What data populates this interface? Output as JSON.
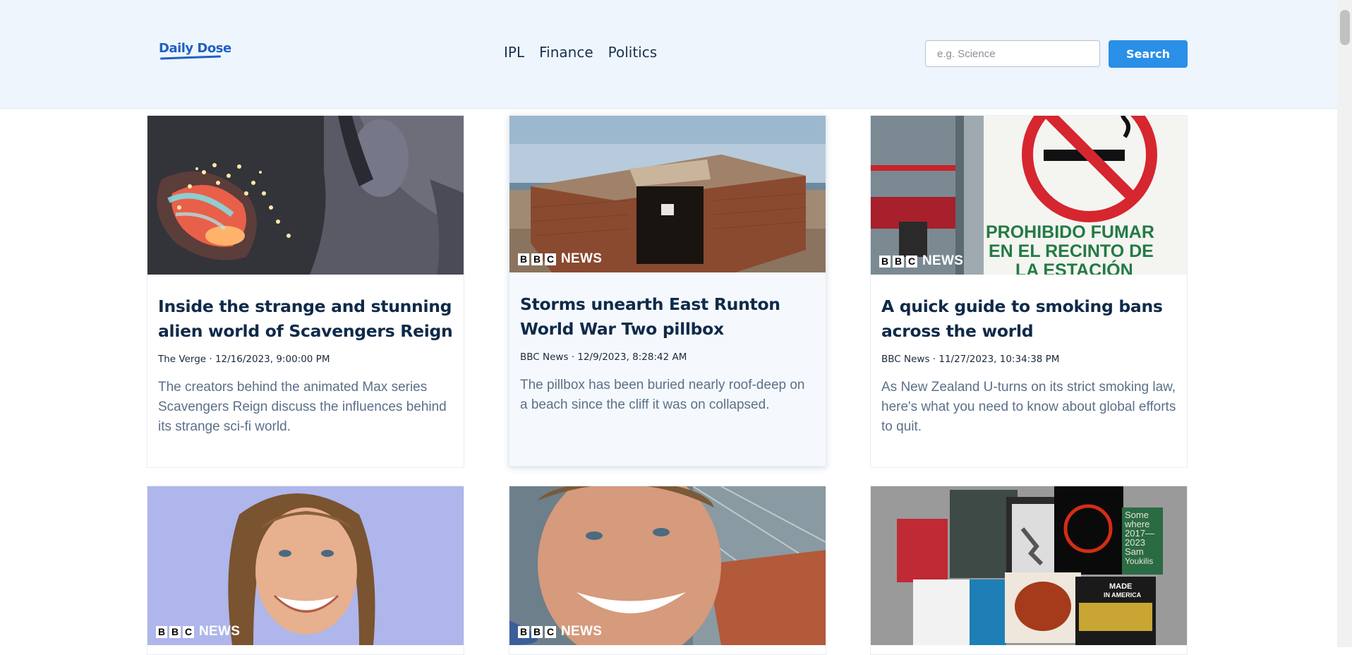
{
  "header": {
    "logo": "Daily Dose",
    "nav": [
      "IPL",
      "Finance",
      "Politics"
    ],
    "search_placeholder": "e.g. Science",
    "search_button": "Search"
  },
  "branding": {
    "bbc_letters": [
      "B",
      "B",
      "C"
    ],
    "bbc_news": "NEWS"
  },
  "articles": [
    {
      "title": "Inside the strange and stunning alien world of Scavengers Reign",
      "meta": "The Verge · 12/16/2023, 9:00:00 PM",
      "description": "The creators behind the animated Max series Scavengers Reign discuss the influences behind its strange sci-fi world."
    },
    {
      "title": "Storms unearth East Runton World War Two pillbox",
      "meta": "BBC News · 12/9/2023, 8:28:42 AM",
      "description": "The pillbox has been buried nearly roof-deep on a beach since the cliff it was on collapsed."
    },
    {
      "title": "A quick guide to smoking bans across the world",
      "meta": "BBC News · 11/27/2023, 10:34:38 PM",
      "description": "As New Zealand U-turns on its strict smoking law, here's what you need to know about global efforts to quit.",
      "image_text": [
        "PROHIBIDO FUMAR",
        "EN EL RECINTO DE",
        "LA ESTACIÓN"
      ]
    },
    {
      "title": "",
      "meta": "",
      "description": ""
    },
    {
      "title": "",
      "meta": "",
      "description": ""
    },
    {
      "title": "",
      "meta": "",
      "description": "",
      "image_text": [
        "Some",
        "where",
        "2017—",
        "2023",
        "Sam",
        "Youkilis",
        "MADE",
        "IN AMERICA"
      ]
    }
  ],
  "colors": {
    "accent": "#2a8fe6",
    "header_bg": "#eef5fd",
    "title": "#0f2a4a"
  }
}
